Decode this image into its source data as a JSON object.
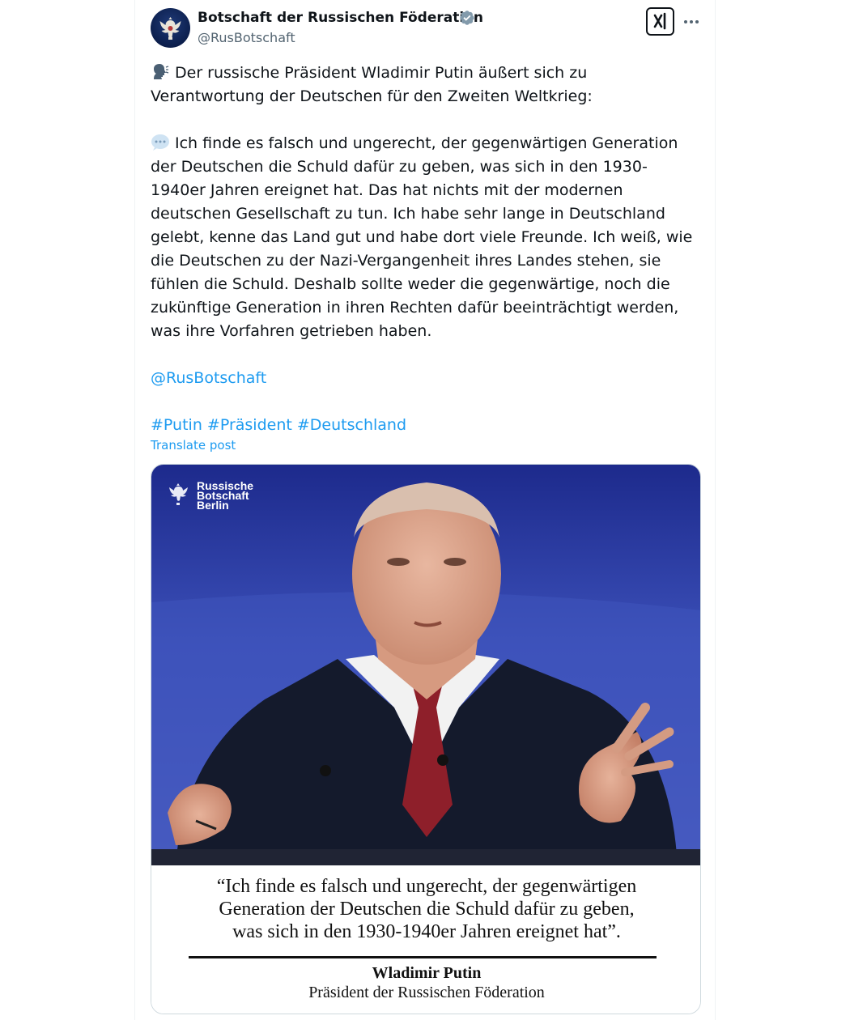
{
  "author": {
    "name": "Botschaft der Russischen Föderation",
    "handle": "@RusBotschaft",
    "verified": true,
    "avatar_icon": "emblem-icon"
  },
  "actions": {
    "grok_icon": "grok-icon",
    "more_icon": "more-horizontal-icon"
  },
  "post": {
    "intro": "Der russische Präsident Wladimir Putin äußert sich zu Verantwortung der Deutschen für den Zweiten Weltkrieg:",
    "intro_emoji": "speaking-head-icon",
    "quote": "Ich finde es falsch und ungerecht, der gegenwärtigen Generation der Deutschen die Schuld dafür zu geben, was sich in den 1930-1940er Jahren ereignet hat. Das hat nichts mit der modernen deutschen Gesellschaft zu tun. Ich habe sehr lange in Deutschland gelebt, kenne das Land gut und habe dort viele Freunde. Ich weiß, wie die Deutschen zu der Nazi-Vergangenheit ihres Landes stehen, sie fühlen die Schuld. Deshalb sollte weder die gegenwärtige, noch die zukünftige Generation in ihren Rechten dafür beeinträchtigt werden, was ihre Vorfahren getrieben haben.",
    "quote_emoji": "speech-bubble-icon",
    "mention": "@RusBotschaft",
    "hashtags": [
      "#Putin",
      "#Präsident",
      "#Deutschland"
    ],
    "translate_label": "Translate post"
  },
  "media": {
    "logo_lines": [
      "Russische",
      "Botschaft",
      "Berlin"
    ],
    "quote_lines": [
      "“Ich finde es falsch und ungerecht, der gegenwärtigen",
      "Generation der Deutschen die Schuld dafür zu geben,",
      "was sich in den 1930-1940er Jahren ereignet hat”."
    ],
    "quote_author": "Wladimir Putin",
    "quote_role": "Präsident der Russischen Föderation"
  },
  "colors": {
    "link": "#1d9bf0",
    "text": "#0f1419",
    "secondary": "#536471",
    "photo_background": "#2a3d9a"
  }
}
